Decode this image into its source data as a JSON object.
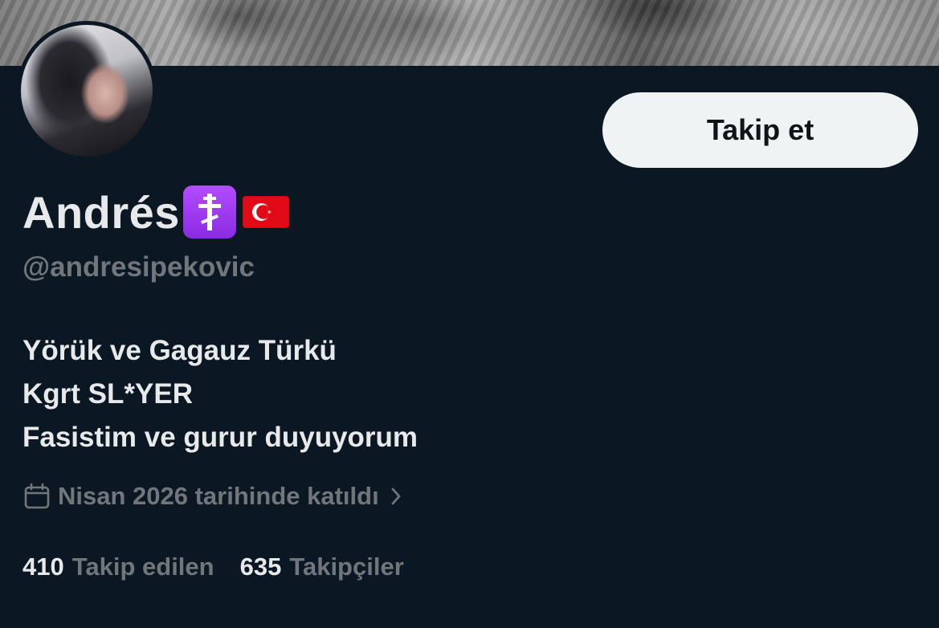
{
  "profile": {
    "display_name": "Andrés",
    "name_emojis": [
      "orthodox-cross-emoji",
      "turkey-flag-emoji"
    ],
    "handle": "@andresipekovic",
    "follow_button_label": "Takip et",
    "bio_lines": [
      "Yörük ve Gagauz Türkü",
      "Kgrt SL*YER",
      "Fasistim ve gurur duyuyorum"
    ],
    "joined_text": "Nisan 2026 tarihinde katıldı",
    "stats": {
      "following_count": "410",
      "following_label": "Takip edilen",
      "followers_count": "635",
      "followers_label": "Takipçiler"
    }
  },
  "colors": {
    "background": "#0b1824",
    "primary_text": "#e7e9ea",
    "secondary_text": "#71767b",
    "button_bg": "#eff3f4",
    "emoji_purple": "#9d3cf0",
    "flag_red": "#e30a17"
  }
}
